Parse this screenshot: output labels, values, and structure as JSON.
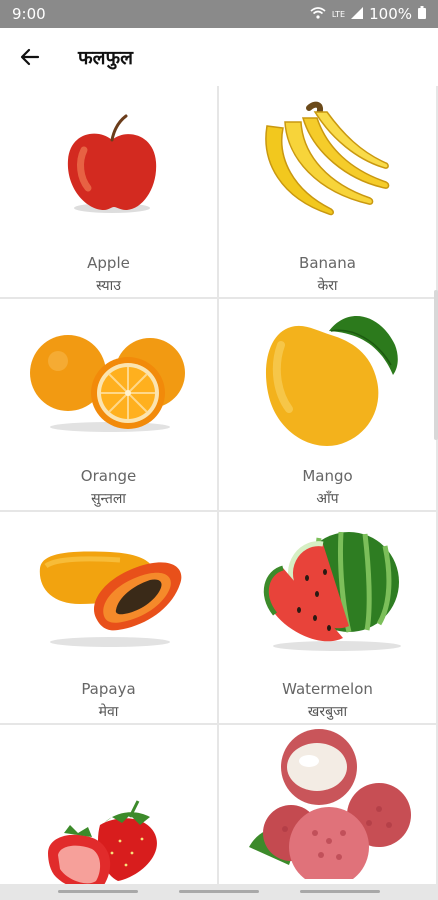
{
  "status": {
    "time": "9:00",
    "network": "LTE",
    "battery": "100%"
  },
  "header": {
    "title": "फलफुल"
  },
  "fruits": [
    {
      "name": "Apple",
      "local": "स्याउ",
      "icon": "apple-icon"
    },
    {
      "name": "Banana",
      "local": "केरा",
      "icon": "banana-icon"
    },
    {
      "name": "Orange",
      "local": "सुन्तला",
      "icon": "orange-icon"
    },
    {
      "name": "Mango",
      "local": "आँप",
      "icon": "mango-icon"
    },
    {
      "name": "Papaya",
      "local": "मेवा",
      "icon": "papaya-icon"
    },
    {
      "name": "Watermelon",
      "local": "खरबुजा",
      "icon": "watermelon-icon"
    },
    {
      "name": "",
      "local": "",
      "icon": "strawberry-icon"
    },
    {
      "name": "",
      "local": "",
      "icon": "lychee-icon"
    }
  ],
  "colors": {
    "status_bar": "#8a8a8a",
    "app_bar": "#ffffff",
    "card": "#ffffff",
    "background": "#e6e6e6"
  }
}
